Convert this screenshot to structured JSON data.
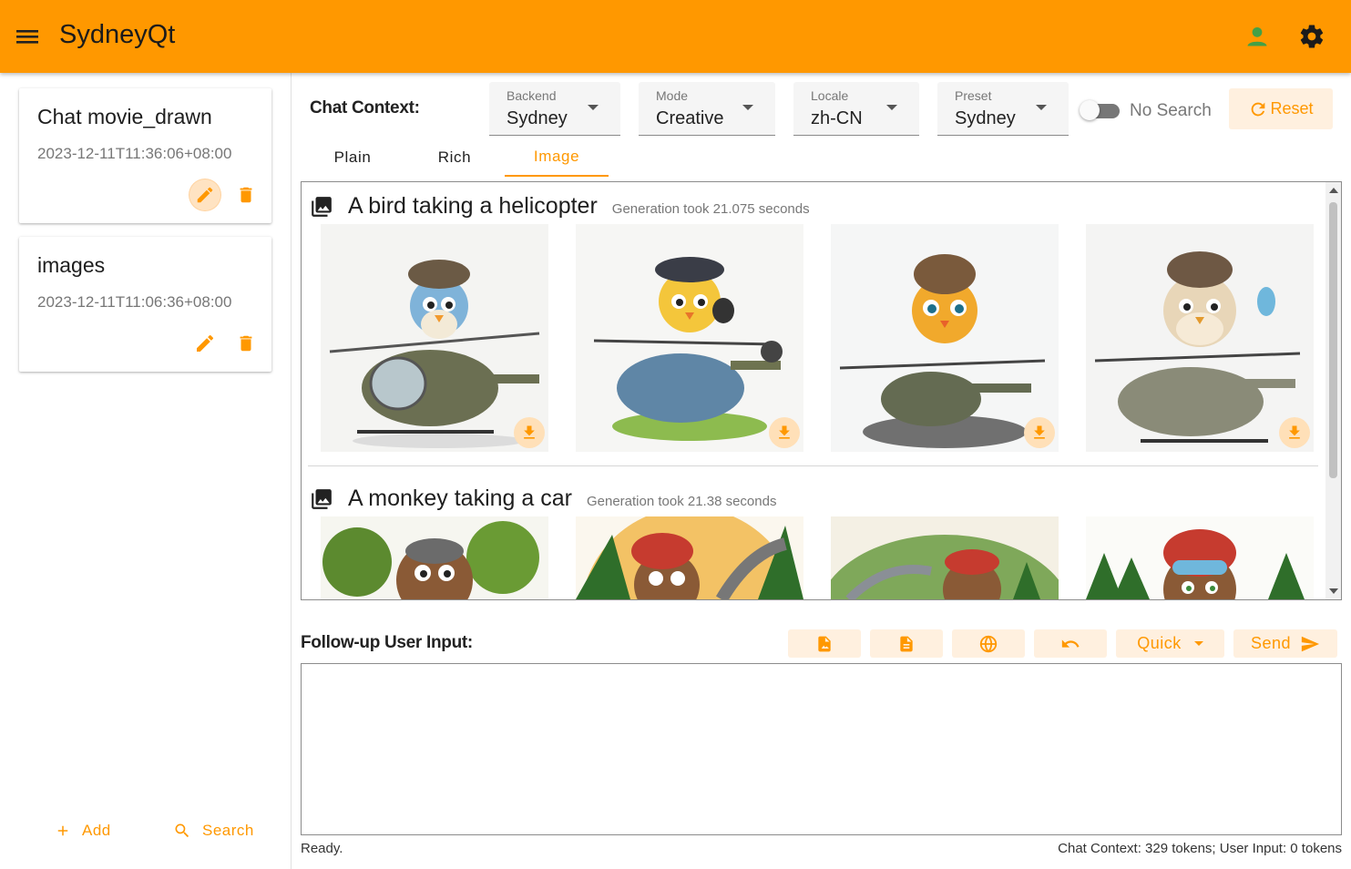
{
  "app": {
    "title": "SydneyQt"
  },
  "colors": {
    "accent": "#ff9800",
    "accent_light": "#fff0df",
    "user_icon": "#43a047"
  },
  "sidebar": {
    "chats": [
      {
        "name": "Chat movie_drawn",
        "time": "2023-12-11T11:36:06+08:00",
        "edit_active": true
      },
      {
        "name": "images",
        "time": "2023-12-11T11:06:36+08:00",
        "edit_active": false
      }
    ],
    "add_label": "Add",
    "search_label": "Search"
  },
  "context": {
    "label": "Chat Context:",
    "selects": [
      {
        "label": "Backend",
        "value": "Sydney"
      },
      {
        "label": "Mode",
        "value": "Creative"
      },
      {
        "label": "Locale",
        "value": "zh-CN"
      },
      {
        "label": "Preset",
        "value": "Sydney"
      }
    ],
    "no_search_label": "No Search",
    "no_search_enabled": false,
    "reset_label": "Reset"
  },
  "tabs": [
    {
      "label": "Plain",
      "active": false
    },
    {
      "label": "Rich",
      "active": false
    },
    {
      "label": "Image",
      "active": true
    }
  ],
  "generations": [
    {
      "prompt": "A bird taking a helicopter",
      "took": "Generation took 21.075 seconds",
      "image_count": 4
    },
    {
      "prompt": "A monkey taking a car",
      "took": "Generation took 21.38 seconds",
      "image_count": 4
    }
  ],
  "followup": {
    "label": "Follow-up User Input:",
    "toolbar": {
      "image_icon": "add-image-icon",
      "doc_icon": "document-icon",
      "web_icon": "globe-icon",
      "undo_icon": "undo-icon",
      "quick_label": "Quick",
      "send_label": "Send"
    },
    "input_value": "",
    "status": "Ready.",
    "token_info": "Chat Context: 329 tokens; User Input: 0 tokens"
  }
}
